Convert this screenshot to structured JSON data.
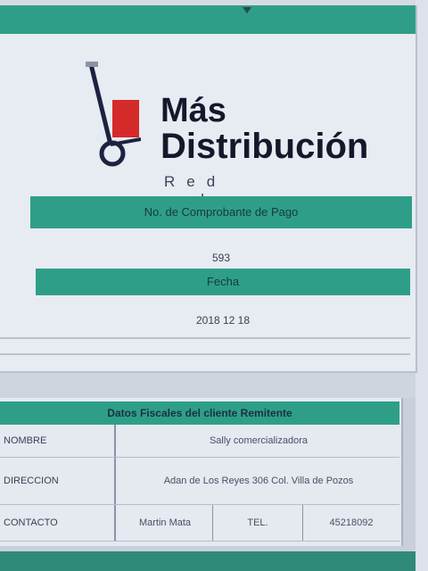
{
  "logo": {
    "line1": "Más",
    "line2": "Distribución",
    "tagline": "Red urbana"
  },
  "folio": {
    "header": "No. de Comprobante de Pago",
    "value": "593"
  },
  "fecha": {
    "header": "Fecha",
    "value": "2018 12 18"
  },
  "client_table": {
    "title": "Datos Fiscales del cliente Remitente",
    "rows": [
      {
        "label": "NOMBRE",
        "value": "Sally comercializadora"
      },
      {
        "label": "DIRECCION",
        "value": "Adan de Los Reyes 306 Col. Villa de Pozos"
      },
      {
        "label": "CONTACTO",
        "name": "Martin Mata",
        "tel_label": "TEL.",
        "tel_value": "45218092"
      }
    ]
  },
  "colors": {
    "accent": "#2f9e88",
    "background": "#e7ebf2"
  },
  "icons": {
    "cart": "hand-truck-icon",
    "sort": "sort-arrow-icon"
  }
}
